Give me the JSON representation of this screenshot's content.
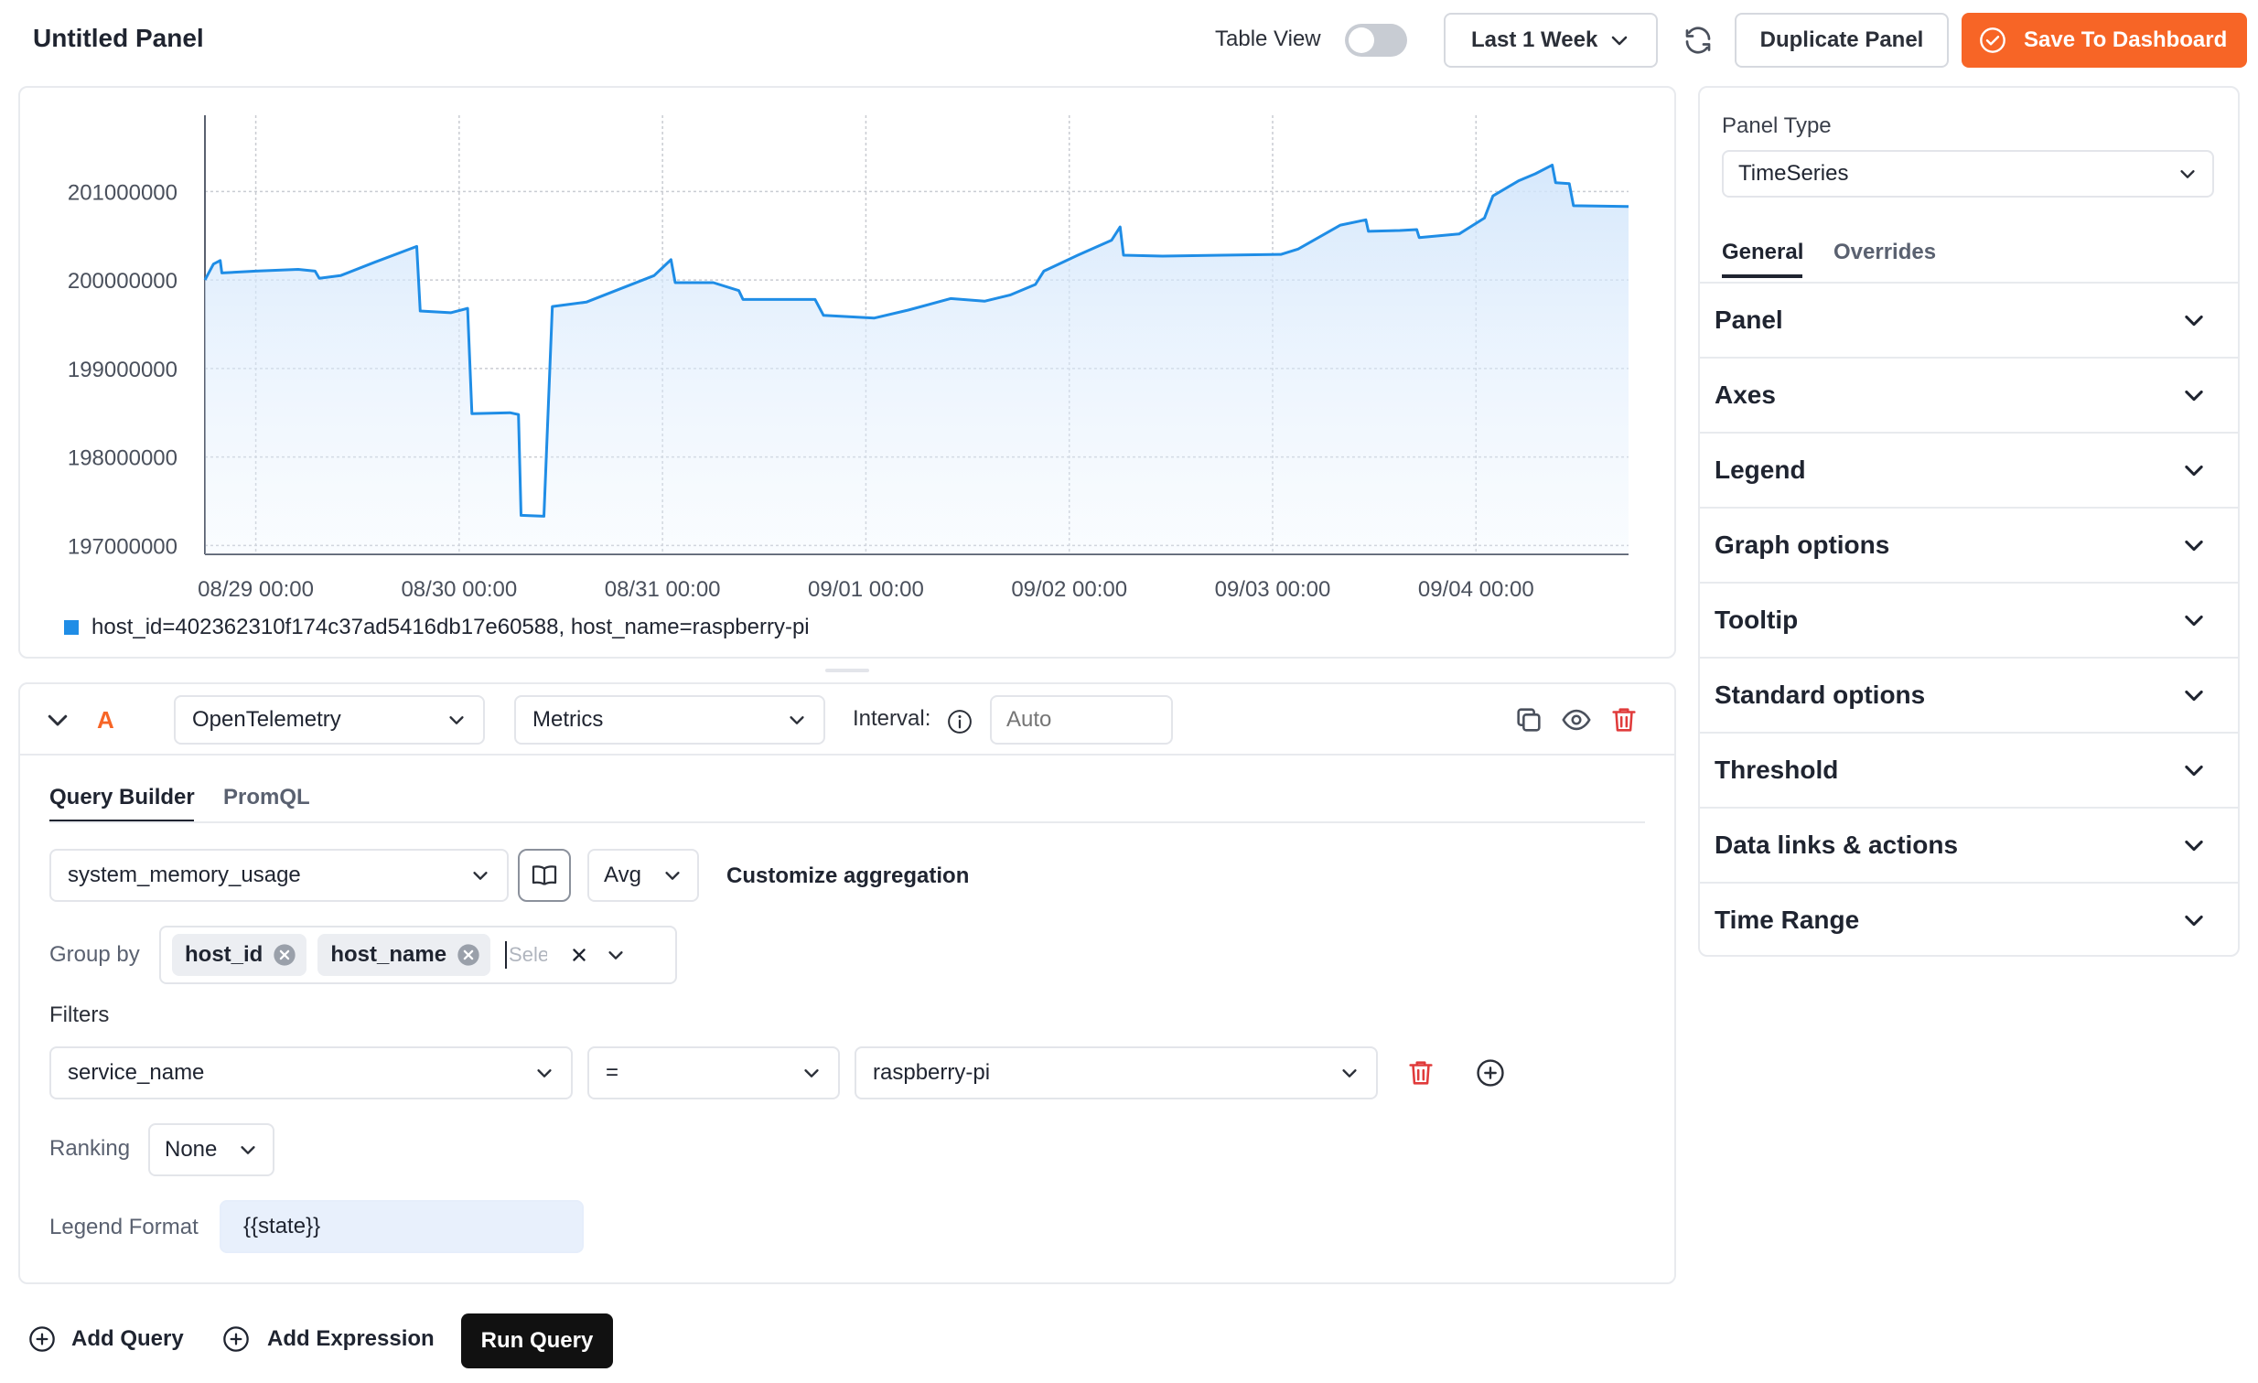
{
  "header": {
    "title": "Untitled Panel",
    "table_view_label": "Table View",
    "table_view_on": false,
    "time_range": "Last 1 Week",
    "duplicate_label": "Duplicate Panel",
    "save_label": "Save To Dashboard",
    "accent": "#f76526"
  },
  "chart_data": {
    "type": "area",
    "y_ticks": [
      "201000000",
      "200000000",
      "199000000",
      "198000000",
      "197000000"
    ],
    "x_ticks": [
      "08/29 00:00",
      "08/30 00:00",
      "08/31 00:00",
      "09/01 00:00",
      "09/02 00:00",
      "09/03 00:00",
      "09/04 00:00"
    ],
    "ylim": [
      196900000,
      201800000
    ],
    "x_unit": "hours since 08/28 18:00",
    "xlim": [
      0,
      168
    ],
    "grid": true,
    "series": [
      {
        "name": "host_id=402362310f174c37ad5416db17e60588, host_name=raspberry-pi",
        "color": "#1f8de6",
        "points": [
          [
            0,
            200000000
          ],
          [
            1,
            200180000
          ],
          [
            1.8,
            200220000
          ],
          [
            2,
            200080000
          ],
          [
            6,
            200100000
          ],
          [
            11,
            200120000
          ],
          [
            13,
            200100000
          ],
          [
            13.5,
            200020000
          ],
          [
            16,
            200050000
          ],
          [
            20,
            200200000
          ],
          [
            25,
            200380000
          ],
          [
            25.4,
            199650000
          ],
          [
            29,
            199630000
          ],
          [
            31,
            199680000
          ],
          [
            31.5,
            198490000
          ],
          [
            36,
            198500000
          ],
          [
            37,
            198480000
          ],
          [
            37.3,
            197340000
          ],
          [
            40,
            197330000
          ],
          [
            41,
            199700000
          ],
          [
            45,
            199750000
          ],
          [
            49,
            199900000
          ],
          [
            53,
            200050000
          ],
          [
            55,
            200230000
          ],
          [
            55.5,
            199970000
          ],
          [
            60,
            199970000
          ],
          [
            63,
            199880000
          ],
          [
            63.5,
            199780000
          ],
          [
            72,
            199780000
          ],
          [
            73,
            199600000
          ],
          [
            79,
            199570000
          ],
          [
            83,
            199660000
          ],
          [
            88,
            199790000
          ],
          [
            92,
            199760000
          ],
          [
            95,
            199830000
          ],
          [
            98,
            199950000
          ],
          [
            99,
            200100000
          ],
          [
            103,
            200280000
          ],
          [
            107,
            200450000
          ],
          [
            108,
            200600000
          ],
          [
            108.4,
            200280000
          ],
          [
            113,
            200270000
          ],
          [
            120,
            200280000
          ],
          [
            127,
            200290000
          ],
          [
            129,
            200350000
          ],
          [
            134,
            200620000
          ],
          [
            137,
            200680000
          ],
          [
            137.3,
            200550000
          ],
          [
            141,
            200560000
          ],
          [
            143,
            200570000
          ],
          [
            143.3,
            200480000
          ],
          [
            148,
            200520000
          ],
          [
            151,
            200700000
          ],
          [
            152,
            200950000
          ],
          [
            155,
            201120000
          ],
          [
            157,
            201200000
          ],
          [
            159,
            201300000
          ],
          [
            159.4,
            201100000
          ],
          [
            161,
            201090000
          ],
          [
            161.5,
            200840000
          ],
          [
            168,
            200830000
          ]
        ]
      }
    ]
  },
  "legend": {
    "entry": "host_id=402362310f174c37ad5416db17e60588, host_name=raspberry-pi",
    "color": "#1f8de6"
  },
  "query": {
    "query_label": "A",
    "data_source": "OpenTelemetry",
    "data_type": "Metrics",
    "interval_label": "Interval:",
    "interval_placeholder": "Auto",
    "tabs": [
      "Query Builder",
      "PromQL"
    ],
    "active_tab": "Query Builder",
    "metric": "system_memory_usage",
    "aggregation": "Avg",
    "customize_label": "Customize aggregation",
    "group_by_label": "Group by",
    "group_by": [
      "host_id",
      "host_name"
    ],
    "group_by_placeholder": "Select",
    "filters_label": "Filters",
    "filter_key": "service_name",
    "filter_op": "=",
    "filter_value": "raspberry-pi",
    "ranking_label": "Ranking",
    "ranking_value": "None",
    "legend_format_label": "Legend Format",
    "legend_format_value": "{{state}}"
  },
  "footer": {
    "add_query": "Add Query",
    "add_expression": "Add Expression",
    "run_query": "Run Query"
  },
  "right_panel": {
    "panel_type_label": "Panel Type",
    "panel_type_value": "TimeSeries",
    "tabs": [
      "General",
      "Overrides"
    ],
    "active_tab": "General",
    "sections": [
      "Panel",
      "Axes",
      "Legend",
      "Graph options",
      "Tooltip",
      "Standard options",
      "Threshold",
      "Data links & actions",
      "Time Range"
    ]
  }
}
